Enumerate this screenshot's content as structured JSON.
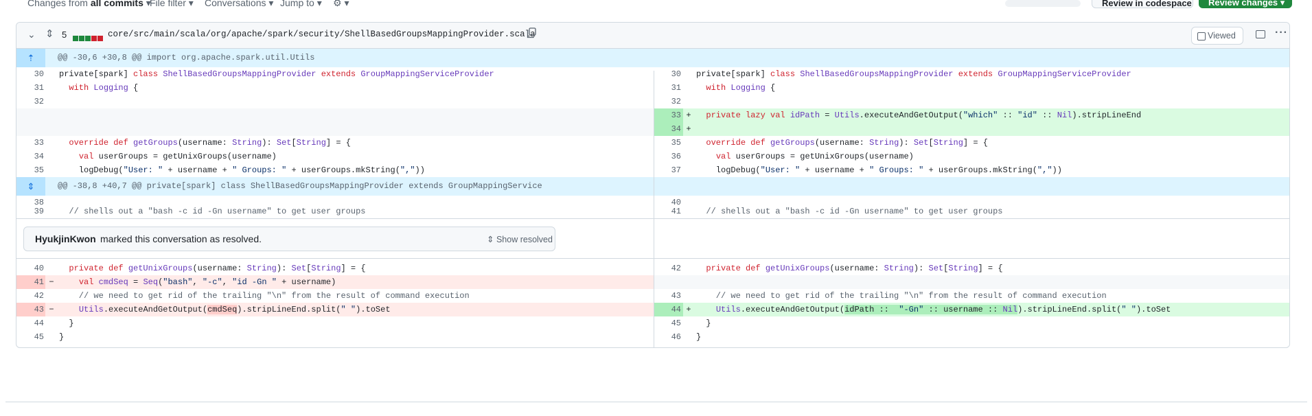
{
  "topbar": {
    "changes_from_label": "Changes from",
    "changes_from_value": "all commits",
    "file_filter": "File filter",
    "conversations": "Conversations",
    "jump_to": "Jump to",
    "review_in_codespace": "Review in codespace",
    "review_changes": "Review changes"
  },
  "file": {
    "changed_count": "5",
    "diffstat_colors": [
      "#1f883d",
      "#1f883d",
      "#1f883d",
      "#cf222e",
      "#cf222e"
    ],
    "path": "core/src/main/scala/org/apache/spark/security/ShellBasedGroupsMappingProvider.scala",
    "viewed_label": "Viewed",
    "hunk1": "@@ -30,6 +30,8 @@ import org.apache.spark.util.Utils",
    "hunk2": "@@ -38,8 +40,7 @@ private[spark] class ShellBasedGroupsMappingProvider extends GroupMappingService",
    "line_numbers": {
      "l30": "30",
      "l31": "31",
      "l32": "32",
      "l33": "33",
      "l34": "34",
      "l35": "35",
      "r30": "30",
      "r31": "31",
      "r32": "32",
      "r33": "33",
      "r34": "34",
      "r35": "35",
      "r36": "36",
      "r37": "37",
      "l38": "38",
      "l39": "39",
      "r40": "40",
      "r41": "41",
      "l40": "40",
      "l41": "41",
      "l42": "42",
      "l43": "43",
      "l44": "44",
      "l45": "45",
      "r42": "42",
      "r43": "43",
      "r44": "44",
      "r45": "45",
      "r46": "46"
    }
  },
  "resolved": {
    "user": "HyukjinKwon",
    "text": "marked this conversation as resolved.",
    "show_resolved": "Show resolved"
  },
  "colors": {
    "added_bg": "#dafbe1",
    "added_num_bg": "#aceebb",
    "removed_bg": "#ffebe9",
    "removed_num_bg": "#ffcecb",
    "hunk_bg": "#ddf4ff",
    "accent_green": "#1f883d"
  }
}
